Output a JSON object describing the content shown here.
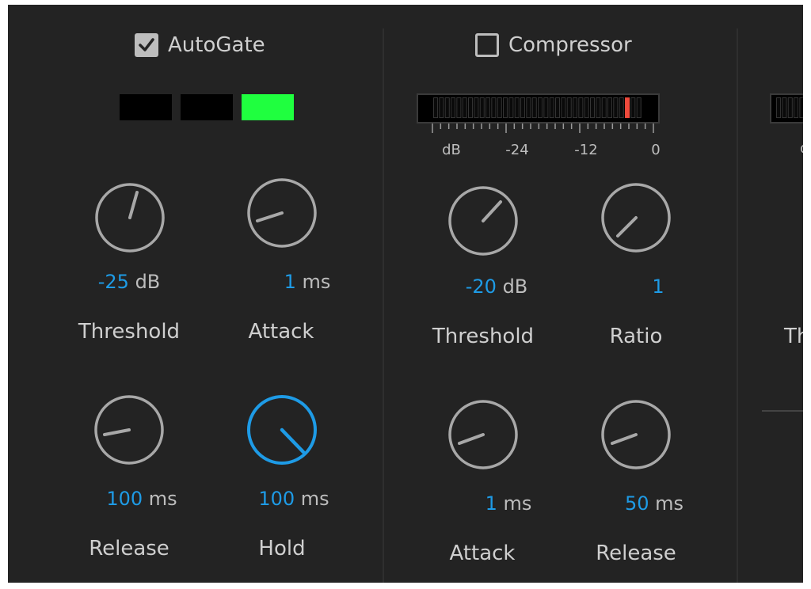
{
  "autogate": {
    "enabled": true,
    "title": "AutoGate",
    "indicator_states": [
      false,
      false,
      true
    ],
    "indicator_color": "#1fff3f",
    "knobs": {
      "threshold": {
        "value": "-25",
        "unit": "dB",
        "label": "Threshold"
      },
      "attack": {
        "value": "1",
        "unit": "ms",
        "label": "Attack"
      },
      "release": {
        "value": "100",
        "unit": "ms",
        "label": "Release"
      },
      "hold": {
        "value": "100",
        "unit": "ms",
        "label": "Hold"
      }
    }
  },
  "compressor": {
    "enabled": false,
    "title": "Compressor",
    "meter": {
      "scale_labels": [
        "dB",
        "-24",
        "-12",
        "0"
      ],
      "peak_color": "#f04a3c"
    },
    "knobs": {
      "threshold": {
        "value": "-20",
        "unit": "dB",
        "label": "Threshold"
      },
      "ratio": {
        "value": "1",
        "unit": "",
        "label": "Ratio"
      },
      "attack": {
        "value": "1",
        "unit": "ms",
        "label": "Attack"
      },
      "release": {
        "value": "50",
        "unit": "ms",
        "label": "Release"
      }
    }
  },
  "third_panel": {
    "partial_scale_label": "d",
    "partial_label": "Th"
  },
  "colors": {
    "panel_bg": "#232323",
    "knob_ring": "#a8a8a8",
    "knob_active": "#1e9be6",
    "value_accent": "#1e9be6"
  }
}
